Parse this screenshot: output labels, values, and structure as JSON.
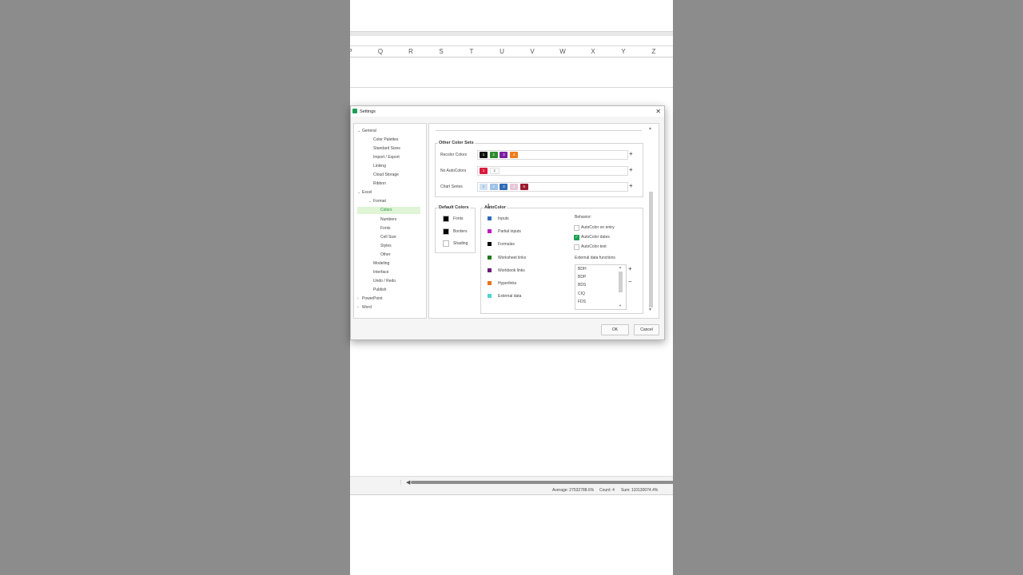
{
  "spreadsheet": {
    "columns": [
      "P",
      "Q",
      "R",
      "S",
      "T",
      "U",
      "V",
      "W",
      "X",
      "Y",
      "Z"
    ],
    "status": {
      "average": "Average: 27532788.6%",
      "count": "Count: 4",
      "sum": "Sum: 110130074.4%"
    }
  },
  "dialog": {
    "title": "Settings",
    "tree": [
      {
        "label": "General",
        "level": 1,
        "expanded": true
      },
      {
        "label": "Color Palettes",
        "level": 2
      },
      {
        "label": "Standard Sizes",
        "level": 2
      },
      {
        "label": "Import / Export",
        "level": 2
      },
      {
        "label": "Linking",
        "level": 2
      },
      {
        "label": "Cloud Storage",
        "level": 2
      },
      {
        "label": "Ribbon",
        "level": 2
      },
      {
        "label": "Excel",
        "level": 1,
        "expanded": true
      },
      {
        "label": "Format",
        "level": 2,
        "expanded": true
      },
      {
        "label": "Colors",
        "level": 3,
        "selected": true
      },
      {
        "label": "Numbers",
        "level": 3
      },
      {
        "label": "Fonts",
        "level": 3
      },
      {
        "label": "Cell Size",
        "level": 3
      },
      {
        "label": "Styles",
        "level": 3
      },
      {
        "label": "Other",
        "level": 3
      },
      {
        "label": "Modeling",
        "level": 2
      },
      {
        "label": "Interface",
        "level": 2
      },
      {
        "label": "Undo / Redo",
        "level": 2
      },
      {
        "label": "Publish",
        "level": 2
      },
      {
        "label": "PowerPoint",
        "level": 1,
        "expanded": false
      },
      {
        "label": "Word",
        "level": 1,
        "expanded": false
      }
    ],
    "other_color_sets": {
      "title": "Other Color Sets",
      "rows": [
        {
          "label": "Recolor Colors",
          "swatches": [
            {
              "n": "1",
              "color": "#111111",
              "text": "#ffffff"
            },
            {
              "n": "2",
              "color": "#2e8b2e",
              "text": "#ffffff"
            },
            {
              "n": "3",
              "color": "#7b1fa2",
              "text": "#ffffff"
            },
            {
              "n": "4",
              "color": "#ef7d1a",
              "text": "#ffffff"
            }
          ]
        },
        {
          "label": "No AutoColors",
          "swatches": [
            {
              "n": "1",
              "color": "#d81b3c",
              "text": "#ffffff"
            },
            {
              "n": "2",
              "color": "#ffffff",
              "text": "#555555"
            }
          ]
        },
        {
          "label": "Chart Series",
          "swatches": [
            {
              "n": "1",
              "color": "#cfe0f3",
              "text": "#5f7fa8"
            },
            {
              "n": "2",
              "color": "#9fc2e6",
              "text": "#ffffff"
            },
            {
              "n": "3",
              "color": "#2f6db6",
              "text": "#ffffff"
            },
            {
              "n": "4",
              "color": "#e7c7d6",
              "text": "#ffffff"
            },
            {
              "n": "5",
              "color": "#9b1a30",
              "text": "#ffffff"
            }
          ]
        }
      ]
    },
    "default_colors": {
      "title": "Default Colors",
      "items": [
        {
          "label": "Fonts",
          "color": "#000000"
        },
        {
          "label": "Borders",
          "color": "#000000"
        },
        {
          "label": "Shading",
          "color": "#ffffff"
        }
      ]
    },
    "autocolor": {
      "title": "AutoColor",
      "items": [
        {
          "label": "Inputs",
          "color": "#2f6db6"
        },
        {
          "label": "Partial inputs",
          "color": "#c218c2"
        },
        {
          "label": "Formulas",
          "color": "#000000"
        },
        {
          "label": "Worksheet links",
          "color": "#1f7a1f"
        },
        {
          "label": "Workbook links",
          "color": "#6a1b7a"
        },
        {
          "label": "Hyperlinks",
          "color": "#e8731a"
        },
        {
          "label": "External data",
          "color": "#4fd3d0"
        }
      ],
      "behavior_label": "Behavior:",
      "behavior_options": [
        {
          "label": "AutoColor on entry",
          "checked": false
        },
        {
          "label": "AutoColor dates",
          "checked": true
        },
        {
          "label": "AutoColor text",
          "checked": false
        }
      ],
      "external_label": "External data functions",
      "external_functions": [
        "BDH",
        "BDP",
        "BDS",
        "CIQ",
        "FDS"
      ]
    },
    "ok_label": "OK",
    "cancel_label": "Cancel"
  }
}
